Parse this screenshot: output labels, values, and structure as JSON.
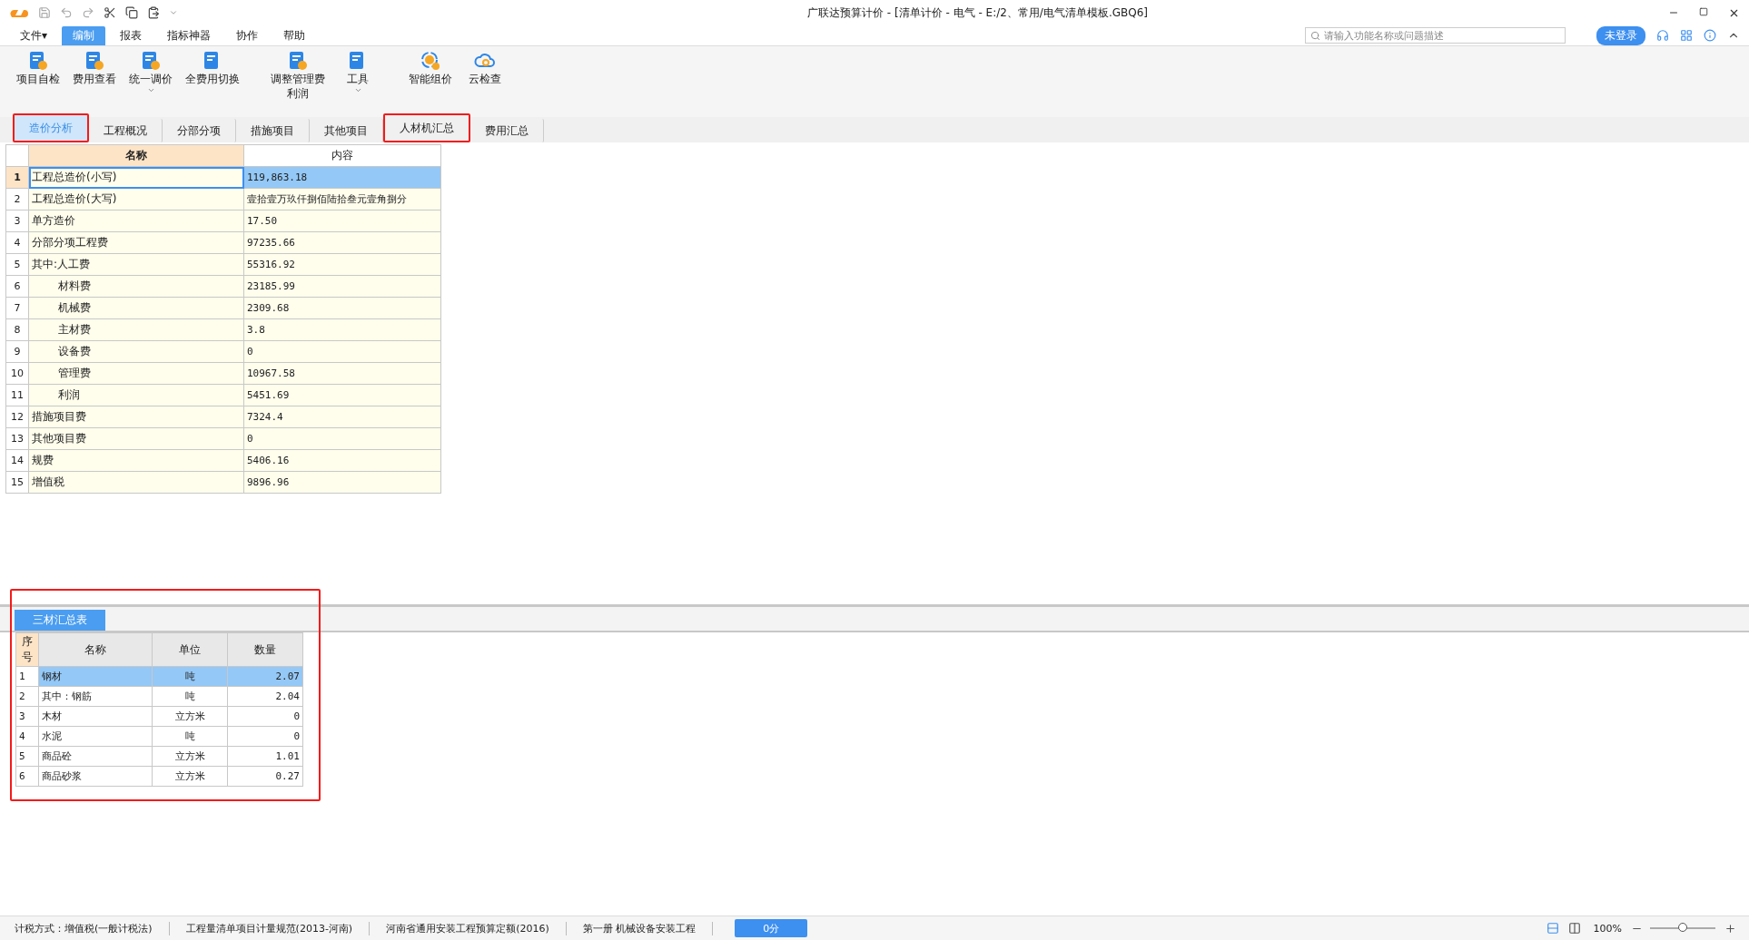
{
  "window": {
    "title": "广联达预算计价 - [清单计价 - 电气 - E:/2、常用/电气清单模板.GBQ6]"
  },
  "menu": [
    {
      "label": "文件▾",
      "selected": false
    },
    {
      "label": "编制",
      "selected": true
    },
    {
      "label": "报表",
      "selected": false
    },
    {
      "label": "指标神器",
      "selected": false
    },
    {
      "label": "协作",
      "selected": false
    },
    {
      "label": "帮助",
      "selected": false
    }
  ],
  "search": {
    "placeholder": "请输入功能名称或问题描述"
  },
  "login_button": "未登录",
  "toolbar": [
    {
      "label": [
        "项目自检"
      ],
      "dropdown": false
    },
    {
      "label": [
        "费用查看"
      ],
      "dropdown": false
    },
    {
      "label": [
        "统一调价"
      ],
      "dropdown": true
    },
    {
      "label": [
        "全费用切换"
      ],
      "dropdown": false
    },
    {
      "label": [
        "调整管理费",
        "利润"
      ],
      "dropdown": false
    },
    {
      "label": [
        "工具"
      ],
      "dropdown": true
    },
    {
      "label": [
        "智能组价"
      ],
      "dropdown": false
    },
    {
      "label": [
        "云检查"
      ],
      "dropdown": false
    }
  ],
  "tabs": [
    {
      "label": "造价分析",
      "selected": true,
      "highlighted": true
    },
    {
      "label": "工程概况",
      "selected": false,
      "highlighted": false
    },
    {
      "label": "分部分项",
      "selected": false,
      "highlighted": false
    },
    {
      "label": "措施项目",
      "selected": false,
      "highlighted": false
    },
    {
      "label": "其他项目",
      "selected": false,
      "highlighted": false
    },
    {
      "label": "人材机汇总",
      "selected": false,
      "highlighted": true
    },
    {
      "label": "费用汇总",
      "selected": false,
      "highlighted": false
    }
  ],
  "table": {
    "columns": [
      "名称",
      "内容"
    ],
    "rows": [
      {
        "no": "1",
        "name": "工程总造价(小写)",
        "value": "119,863.18",
        "kind": "item",
        "selected": true
      },
      {
        "no": "2",
        "name": "工程总造价(大写)",
        "value": "壹拾壹万玖仟捌佰陆拾叁元壹角捌分",
        "kind": "item",
        "selected": false
      },
      {
        "no": "3",
        "name": "单方造价",
        "value": "17.50",
        "kind": "item",
        "selected": false
      },
      {
        "no": "4",
        "name": "分部分项工程费",
        "value": "97235.66",
        "kind": "item",
        "selected": false
      },
      {
        "no": "5",
        "name": "其中:人工费",
        "value": "55316.92",
        "kind": "item",
        "selected": false
      },
      {
        "no": "6",
        "name": "材料费",
        "value": "23185.99",
        "kind": "subitem",
        "selected": false
      },
      {
        "no": "7",
        "name": "机械费",
        "value": "2309.68",
        "kind": "subitem",
        "selected": false
      },
      {
        "no": "8",
        "name": "主材费",
        "value": "3.8",
        "kind": "subitem",
        "selected": false
      },
      {
        "no": "9",
        "name": "设备费",
        "value": "0",
        "kind": "subitem",
        "selected": false
      },
      {
        "no": "10",
        "name": "管理费",
        "value": "10967.58",
        "kind": "subitem",
        "selected": false
      },
      {
        "no": "11",
        "name": "利润",
        "value": "5451.69",
        "kind": "subitem",
        "selected": false
      },
      {
        "no": "12",
        "name": "措施项目费",
        "value": "7324.4",
        "kind": "item",
        "selected": false
      },
      {
        "no": "13",
        "name": "其他项目费",
        "value": "0",
        "kind": "item",
        "selected": false
      },
      {
        "no": "14",
        "name": "规费",
        "value": "5406.16",
        "kind": "item",
        "selected": false
      },
      {
        "no": "15",
        "name": "增值税",
        "value": "9896.96",
        "kind": "item",
        "selected": false
      }
    ]
  },
  "bottom_panel": {
    "highlighted": true,
    "tab": {
      "label": "三材汇总表",
      "selected": true
    },
    "columns": [
      "序号",
      "名称",
      "单位",
      "数量"
    ],
    "rows": [
      {
        "cells": [
          "1",
          "钢材",
          "吨",
          "2.07"
        ],
        "selected": true
      },
      {
        "cells": [
          "2",
          "其中：钢筋",
          "吨",
          "2.04"
        ],
        "selected": false
      },
      {
        "cells": [
          "3",
          "木材",
          "立方米",
          "0"
        ],
        "selected": false
      },
      {
        "cells": [
          "4",
          "水泥",
          "吨",
          "0"
        ],
        "selected": false
      },
      {
        "cells": [
          "5",
          "商品砼",
          "立方米",
          "1.01"
        ],
        "selected": false
      },
      {
        "cells": [
          "6",
          "商品砂浆",
          "立方米",
          "0.27"
        ],
        "selected": false
      }
    ]
  },
  "status_bar": {
    "items": [
      "计税方式：增值税(一般计税法)",
      "工程量清单项目计量规范(2013-河南)",
      "河南省通用安装工程预算定额(2016)",
      "第一册 机械设备安装工程"
    ],
    "score": "0分",
    "zoom": "100%",
    "zoom_level": {
      "level": 0.5
    }
  }
}
